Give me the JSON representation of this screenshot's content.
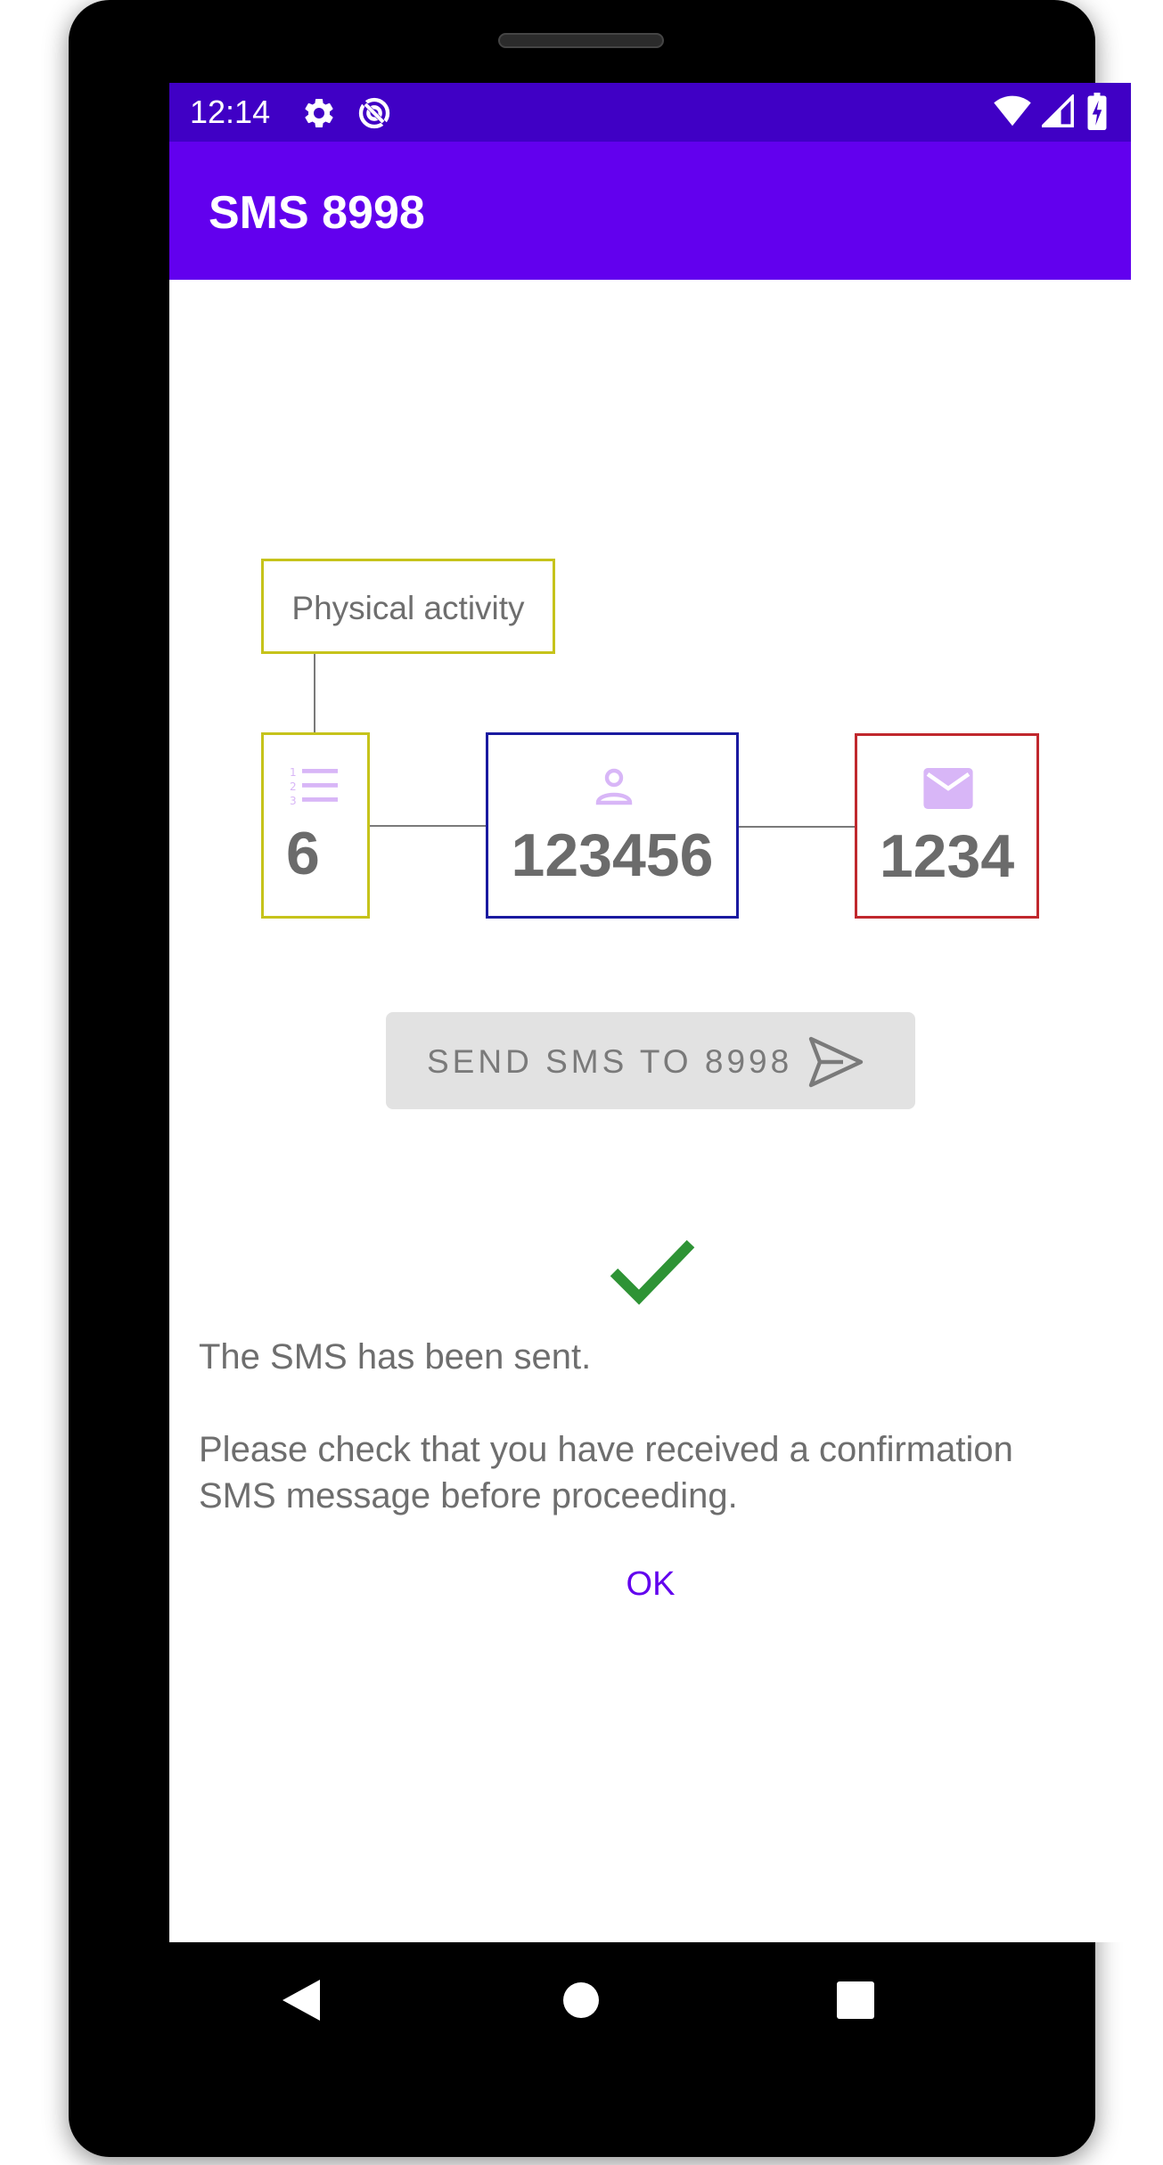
{
  "status_bar": {
    "time": "12:14",
    "left_icons": [
      "gear-icon",
      "sync-icon"
    ],
    "right_icons": [
      "wifi-icon",
      "signal-icon",
      "battery-charging-icon"
    ],
    "color": "#4000c5"
  },
  "app_bar": {
    "title": "SMS 8998",
    "color": "#6200ee"
  },
  "diagram": {
    "activity": {
      "label": "Physical activity",
      "border_color": "#c6c31b"
    },
    "count": {
      "icon": "numbered-list-icon",
      "value": "6",
      "border_color": "#c6c31b"
    },
    "participant_id": {
      "icon": "person-icon",
      "value": "123456",
      "border_color": "#1a1aa0"
    },
    "code": {
      "icon": "mail-icon",
      "value": "1234",
      "border_color": "#c0282d"
    },
    "icon_color": "#d8b6f7"
  },
  "send_button": {
    "label": "SEND SMS TO 8998",
    "icon": "send-icon",
    "enabled": false
  },
  "result": {
    "icon": "checkmark-icon",
    "icon_color": "#2e9335",
    "message": "The SMS has been sent.",
    "instruction": "Please check that you have received a confirmation SMS message before proceeding.",
    "ok_label": "OK",
    "accent": "#6200ee"
  },
  "nav_bar": {
    "items": [
      "back-icon",
      "home-icon",
      "recents-icon"
    ]
  }
}
